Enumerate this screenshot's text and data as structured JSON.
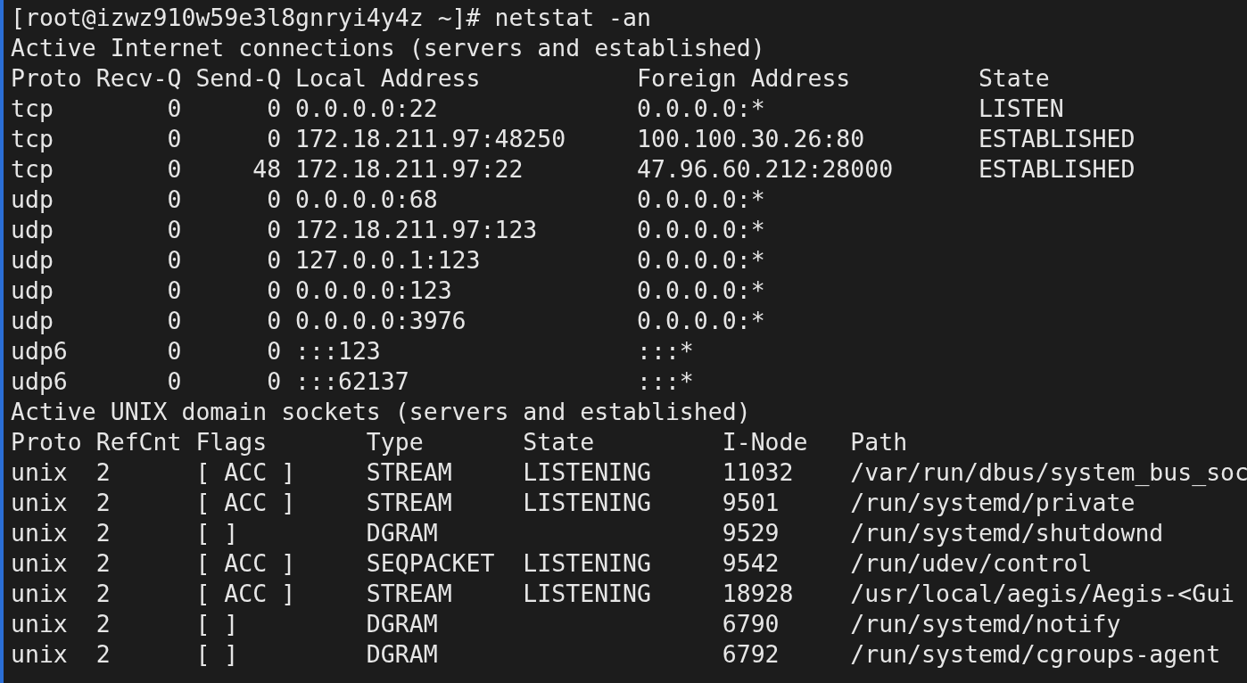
{
  "terminal": {
    "lines": [
      "[root@izwz910w59e3l8gnryi4y4z ~]# netstat -an",
      "Active Internet connections (servers and established)",
      "Proto Recv-Q Send-Q Local Address           Foreign Address         State",
      "tcp        0      0 0.0.0.0:22              0.0.0.0:*               LISTEN",
      "tcp        0      0 172.18.211.97:48250     100.100.30.26:80        ESTABLISHED",
      "tcp        0     48 172.18.211.97:22        47.96.60.212:28000      ESTABLISHED",
      "udp        0      0 0.0.0.0:68              0.0.0.0:*",
      "udp        0      0 172.18.211.97:123       0.0.0.0:*",
      "udp        0      0 127.0.0.1:123           0.0.0.0:*",
      "udp        0      0 0.0.0.0:123             0.0.0.0:*",
      "udp        0      0 0.0.0.0:3976            0.0.0.0:*",
      "udp6       0      0 :::123                  :::*",
      "udp6       0      0 :::62137                :::*",
      "Active UNIX domain sockets (servers and established)",
      "Proto RefCnt Flags       Type       State         I-Node   Path",
      "unix  2      [ ACC ]     STREAM     LISTENING     11032    /var/run/dbus/system_bus_soc",
      "unix  2      [ ACC ]     STREAM     LISTENING     9501     /run/systemd/private",
      "unix  2      [ ]         DGRAM                    9529     /run/systemd/shutdownd",
      "unix  2      [ ACC ]     SEQPACKET  LISTENING     9542     /run/udev/control",
      "unix  2      [ ACC ]     STREAM     LISTENING     18928    /usr/local/aegis/Aegis-<Gui",
      "unix  2      [ ]         DGRAM                    6790     /run/systemd/notify",
      "unix  2      [ ]         DGRAM                    6792     /run/systemd/cgroups-agent"
    ]
  }
}
